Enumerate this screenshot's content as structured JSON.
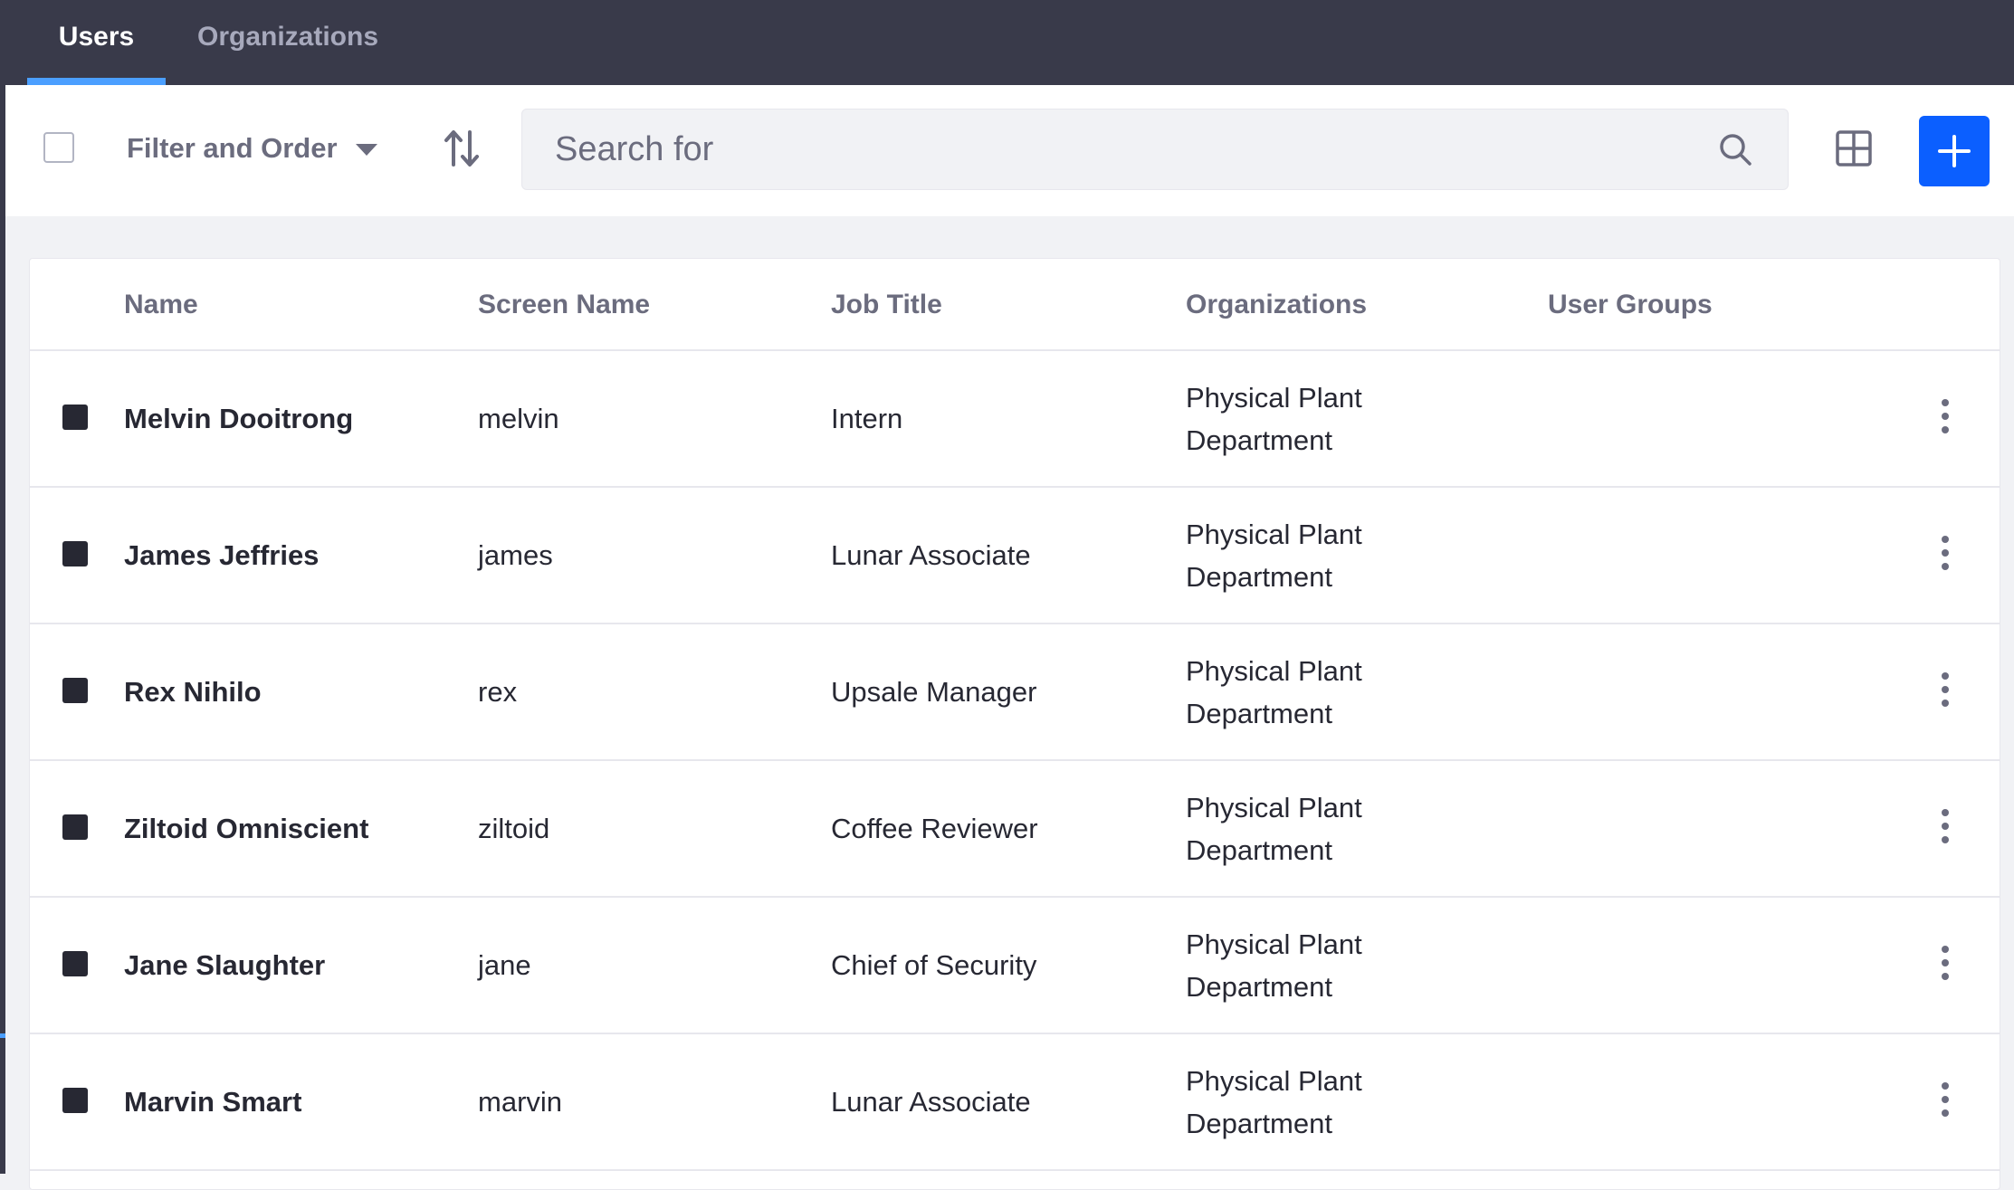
{
  "tabs": [
    {
      "label": "Users",
      "active": true
    },
    {
      "label": "Organizations",
      "active": false
    }
  ],
  "toolbar": {
    "filter_label": "Filter and Order",
    "search_placeholder": "Search for",
    "icons": {
      "sort": "sort-arrows-icon",
      "search": "search-icon",
      "view": "cards-view-icon",
      "add": "plus-icon"
    },
    "accent_color": "#0b5fff"
  },
  "table": {
    "columns": [
      "Name",
      "Screen Name",
      "Job Title",
      "Organizations",
      "User Groups"
    ],
    "rows": [
      {
        "name": "Melvin Dooitrong",
        "screen_name": "melvin",
        "job_title": "Intern",
        "organizations": "Physical Plant Department",
        "user_groups": ""
      },
      {
        "name": "James Jeffries",
        "screen_name": "james",
        "job_title": "Lunar Associate",
        "organizations": "Physical Plant Department",
        "user_groups": ""
      },
      {
        "name": "Rex Nihilo",
        "screen_name": "rex",
        "job_title": "Upsale Manager",
        "organizations": "Physical Plant Department",
        "user_groups": ""
      },
      {
        "name": "Ziltoid Omniscient",
        "screen_name": "ziltoid",
        "job_title": "Coffee Reviewer",
        "organizations": "Physical Plant Department",
        "user_groups": ""
      },
      {
        "name": "Jane Slaughter",
        "screen_name": "jane",
        "job_title": "Chief of Security",
        "organizations": "Physical Plant Department",
        "user_groups": ""
      },
      {
        "name": "Marvin Smart",
        "screen_name": "marvin",
        "job_title": "Lunar Associate",
        "organizations": "Physical Plant Department",
        "user_groups": ""
      }
    ]
  }
}
